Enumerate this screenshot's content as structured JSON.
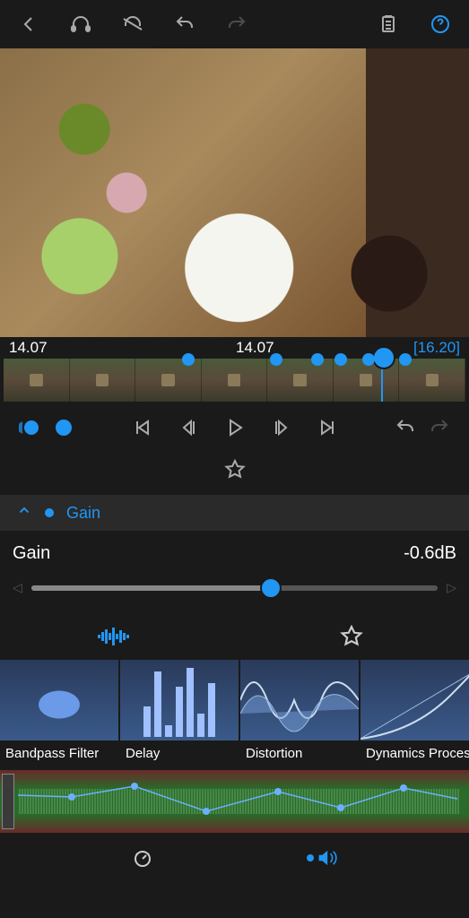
{
  "accent": "#2196f3",
  "timeline": {
    "t_left": "14.07",
    "t_mid": "14.07",
    "t_right": "[16.20]",
    "markers_pct": [
      40,
      59,
      68,
      73,
      79,
      87
    ],
    "playhead_pct": 82
  },
  "param": {
    "header_label": "Gain",
    "name": "Gain",
    "value": "-0.6dB",
    "slider_pct": 59
  },
  "effects": [
    {
      "label": "Bandpass Filter",
      "kind": "bandpass"
    },
    {
      "label": "Delay",
      "kind": "delay"
    },
    {
      "label": "Distortion",
      "kind": "distortion"
    },
    {
      "label": "Dynamics Processor",
      "kind": "dynamics"
    }
  ],
  "icons": {
    "back": "back",
    "headphones": "headphones",
    "automation": "automation",
    "undo": "undo",
    "redo": "redo",
    "clipboard": "clipboard",
    "help": "help",
    "star": "star",
    "speed": "speedometer",
    "speaker": "speaker"
  }
}
